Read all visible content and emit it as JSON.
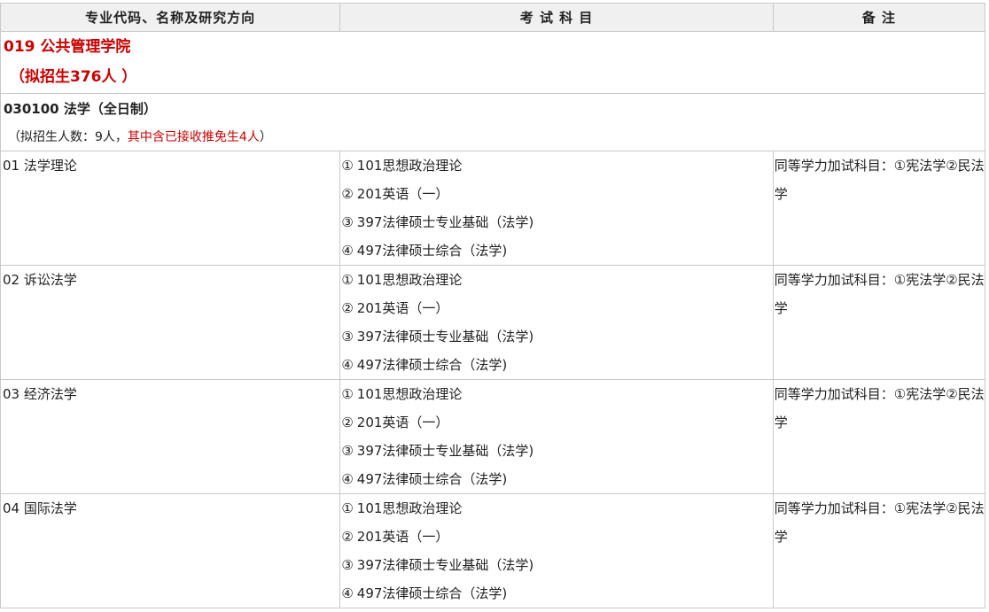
{
  "headers": {
    "col1": "专业代码、名称及研究方向",
    "col2": "考 试 科 目",
    "col3": "备 注"
  },
  "college": {
    "name": "019 公共管理学院",
    "quota": "（拟招生376人 ）"
  },
  "major": {
    "code": "030100 法学（全日制）",
    "quota_prefix": "（拟招生人数：9人，",
    "quota_red": "其中含已接收推免生4人",
    "quota_suffix": "）"
  },
  "directions": [
    {
      "name": "01 法学理论",
      "subjects": [
        {
          "num": "①",
          "text": "101思想政治理论"
        },
        {
          "num": "②",
          "text": "201英语（一）"
        },
        {
          "num": "③",
          "text": "397法律硕士专业基础（法学)"
        },
        {
          "num": "④",
          "text": "497法律硕士综合（法学)"
        }
      ],
      "note": "同等学力加试科目：①宪法学②民法学"
    },
    {
      "name": "02 诉讼法学",
      "subjects": [
        {
          "num": "①",
          "text": "101思想政治理论"
        },
        {
          "num": "②",
          "text": "201英语（一）"
        },
        {
          "num": "③",
          "text": "397法律硕士专业基础（法学)"
        },
        {
          "num": "④",
          "text": "497法律硕士综合（法学)"
        }
      ],
      "note": "同等学力加试科目：①宪法学②民法学"
    },
    {
      "name": "03 经济法学",
      "subjects": [
        {
          "num": "①",
          "text": "101思想政治理论"
        },
        {
          "num": "②",
          "text": "201英语（一）"
        },
        {
          "num": "③",
          "text": "397法律硕士专业基础（法学)"
        },
        {
          "num": "④",
          "text": "497法律硕士综合（法学)"
        }
      ],
      "note": "同等学力加试科目：①宪法学②民法学"
    },
    {
      "name": "04 国际法学",
      "subjects": [
        {
          "num": "①",
          "text": "101思想政治理论"
        },
        {
          "num": "②",
          "text": "201英语（一）"
        },
        {
          "num": "③",
          "text": "397法律硕士专业基础（法学)"
        },
        {
          "num": "④",
          "text": "497法律硕士综合（法学)"
        }
      ],
      "note": "同等学力加试科目：①宪法学②民法学"
    }
  ]
}
